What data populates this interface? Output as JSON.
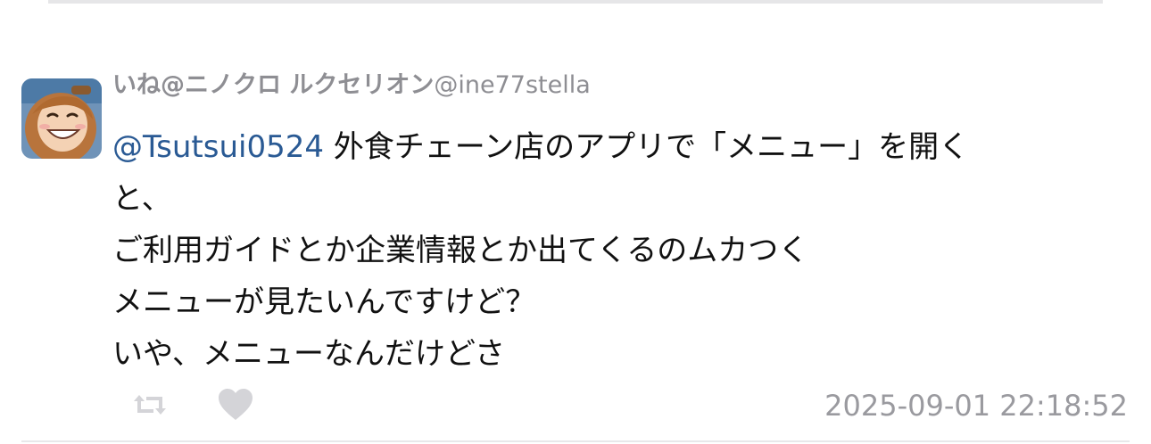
{
  "tweet": {
    "display_name": "いね@ニノクロ ルクセリオン",
    "handle": "@ine77stella",
    "mention": "@Tsutsui0524",
    "text_line1": " 外食チェーン店のアプリで「メニュー」を開く",
    "text_line2": "と、",
    "text_line3": "ご利用ガイドとか企業情報とか出てくるのムカつく",
    "text_line4": "メニューが見たいんですけど？",
    "text_line5": "いや、メニューなんだけどさ",
    "timestamp": "2025-09-01 22:18:52"
  },
  "icons": {
    "retweet": "retweet-icon",
    "like": "heart-icon"
  },
  "colors": {
    "mention": "#2a5a94",
    "muted": "#8e8e93",
    "icon": "#d4d4d8"
  }
}
